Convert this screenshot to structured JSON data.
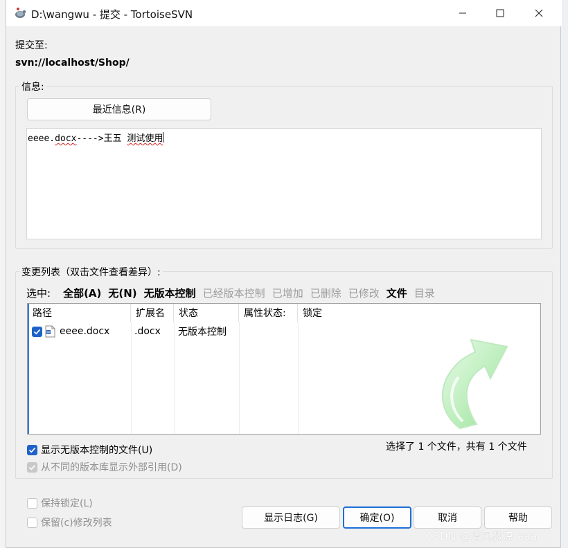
{
  "window": {
    "title": "D:\\wangwu - 提交 - TortoiseSVN",
    "icon": "tortoise-icon",
    "controls": [
      "minimize-icon",
      "maximize-icon",
      "close-icon"
    ]
  },
  "commit_to": {
    "label": "提交至:",
    "url": "svn://localhost/Shop/"
  },
  "message_group": {
    "title": "信息:",
    "recent_button": "最近信息(R)",
    "message_part1": "eeee.",
    "message_squiggle1": "docx",
    "message_part2": "---->",
    "message_part3": "王五 ",
    "message_squiggle2": "测试使用"
  },
  "changes_group": {
    "title": "变更列表（双击文件查看差异）:",
    "select_label": "选中:",
    "filters": [
      {
        "label": "全部(A)",
        "state": "active"
      },
      {
        "label": "无(N)",
        "state": "active"
      },
      {
        "label": "无版本控制",
        "state": "active"
      },
      {
        "label": "已经版本控制",
        "state": "disabled"
      },
      {
        "label": "已增加",
        "state": "disabled"
      },
      {
        "label": "已删除",
        "state": "disabled"
      },
      {
        "label": "已修改",
        "state": "disabled"
      },
      {
        "label": "文件",
        "state": "active"
      },
      {
        "label": "目录",
        "state": "disabled"
      }
    ],
    "columns": [
      "路径",
      "扩展名",
      "状态",
      "属性状态:",
      "锁定"
    ],
    "rows": [
      {
        "checked": true,
        "path": "eeee.docx",
        "ext": ".docx",
        "status": "无版本控制",
        "prop_status": "",
        "lock": ""
      }
    ],
    "show_unversioned": {
      "label": "显示无版本控制的文件(U)",
      "checked": true
    },
    "show_externals": {
      "label": "从不同的版本库显示外部引用(D)",
      "checked": true,
      "disabled": true
    },
    "summary": "选择了 1 个文件，共有 1 个文件"
  },
  "bottom": {
    "keep_locks": {
      "label": "保持锁定(L)",
      "checked": false
    },
    "keep_changelists": {
      "label": "保留(c)修改列表",
      "checked": false
    },
    "buttons": {
      "show_log": "显示日志(G)",
      "ok": "确定(O)",
      "cancel": "取消",
      "help": "帮助"
    }
  },
  "watermark": "CSDN @清风微凉 aaa",
  "colors": {
    "accent": "#1d6fd6",
    "checkbox": "#1e62c9",
    "disabled_text": "#9c9c9c",
    "arrow_green": "#9ae39a"
  }
}
